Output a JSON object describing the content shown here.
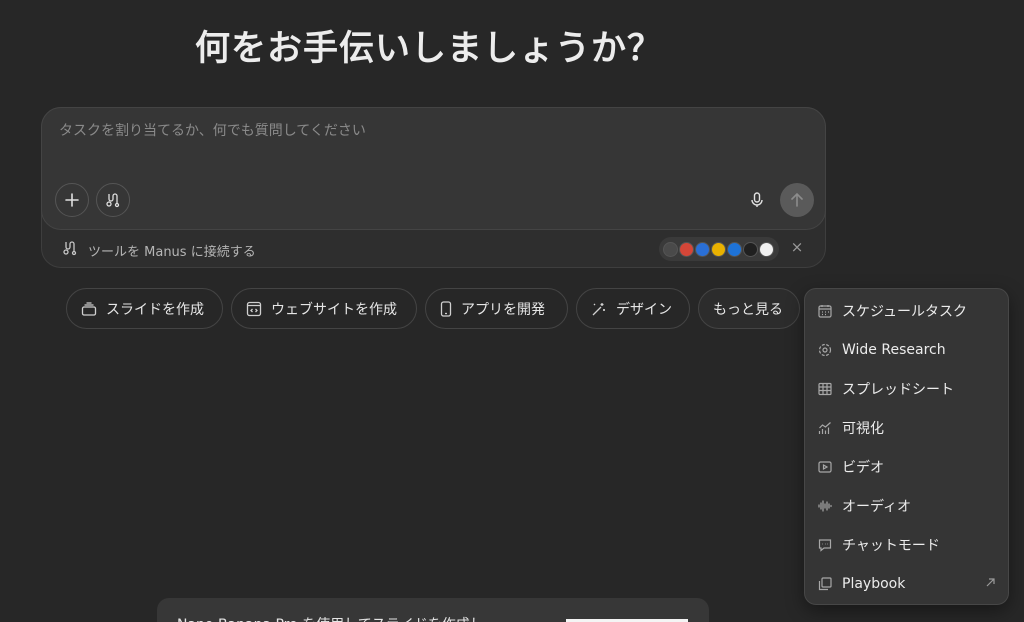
{
  "headline": "何をお手伝いしましょうか？",
  "composer": {
    "placeholder": "タスクを割り当てるか、何でも質問してください",
    "tools_label": "ツールを Manus に接続する",
    "close_symbol": "×"
  },
  "integrations": [
    {
      "icon": "chrome-icon",
      "color": "#4a4a4a"
    },
    {
      "icon": "gmail-icon",
      "color": "#d44638"
    },
    {
      "icon": "outlook-calendar-icon",
      "color": "#2a6fd6"
    },
    {
      "icon": "google-drive-icon",
      "color": "#e9b100"
    },
    {
      "icon": "outlook-mail-icon",
      "color": "#1e73d8"
    },
    {
      "icon": "github-icon",
      "color": "#202020"
    },
    {
      "icon": "notion-icon",
      "color": "#f1f1f1"
    }
  ],
  "chips": [
    {
      "label": "スライドを作成",
      "icon": "slides-icon"
    },
    {
      "label": "ウェブサイトを作成",
      "icon": "website-code-icon"
    },
    {
      "label": "アプリを開発",
      "icon": "mobile-app-icon"
    },
    {
      "label": "デザイン",
      "icon": "design-wand-icon"
    },
    {
      "label": "もっと見る",
      "icon": ""
    }
  ],
  "menu": {
    "items": [
      {
        "label": "スケジュールタスク",
        "icon": "calendar-icon"
      },
      {
        "label": "Wide Research",
        "icon": "wide-research-icon"
      },
      {
        "label": "スプレッドシート",
        "icon": "spreadsheet-icon"
      },
      {
        "label": "可視化",
        "icon": "chart-icon"
      },
      {
        "label": "ビデオ",
        "icon": "video-icon"
      },
      {
        "label": "オーディオ",
        "icon": "audio-wave-icon"
      },
      {
        "label": "チャットモード",
        "icon": "chat-icon"
      },
      {
        "label": "Playbook",
        "icon": "playbook-icon"
      }
    ]
  },
  "toast": {
    "text": "Nano Banana Pro を使用してスライドを作成し"
  },
  "colors": {
    "background": "#272727",
    "composer": "#363636",
    "menu": "#353535",
    "send_button": "#5a5a5a"
  }
}
